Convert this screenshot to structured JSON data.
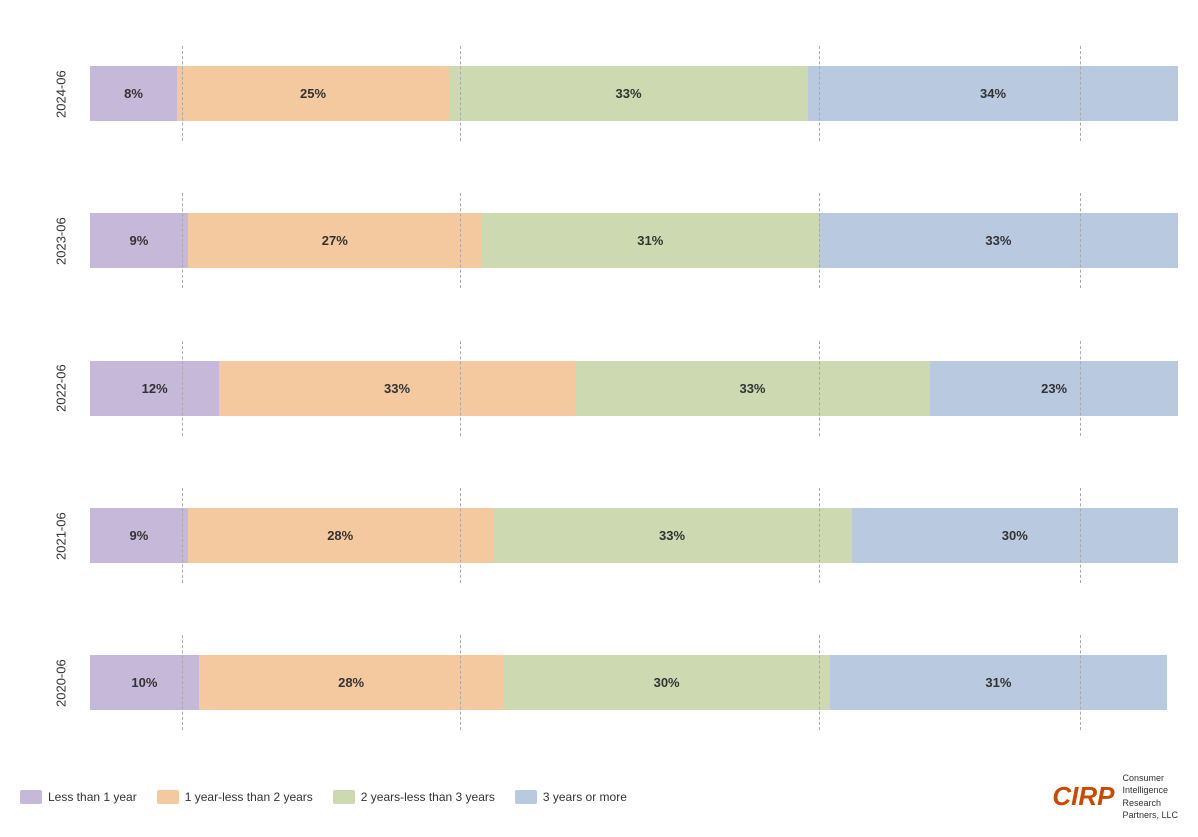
{
  "chart": {
    "bars": [
      {
        "year": "2024-06",
        "segments": [
          {
            "label": "8%",
            "pct": 8,
            "class": "seg-purple"
          },
          {
            "label": "25%",
            "pct": 25,
            "class": "seg-orange"
          },
          {
            "label": "33%",
            "pct": 33,
            "class": "seg-green"
          },
          {
            "label": "34%",
            "pct": 34,
            "class": "seg-blue"
          }
        ]
      },
      {
        "year": "2023-06",
        "segments": [
          {
            "label": "9%",
            "pct": 9,
            "class": "seg-purple"
          },
          {
            "label": "27%",
            "pct": 27,
            "class": "seg-orange"
          },
          {
            "label": "31%",
            "pct": 31,
            "class": "seg-green"
          },
          {
            "label": "33%",
            "pct": 33,
            "class": "seg-blue"
          }
        ]
      },
      {
        "year": "2022-06",
        "segments": [
          {
            "label": "12%",
            "pct": 12,
            "class": "seg-purple"
          },
          {
            "label": "33%",
            "pct": 33,
            "class": "seg-orange"
          },
          {
            "label": "33%",
            "pct": 33,
            "class": "seg-green"
          },
          {
            "label": "23%",
            "pct": 23,
            "class": "seg-blue"
          }
        ]
      },
      {
        "year": "2021-06",
        "segments": [
          {
            "label": "9%",
            "pct": 9,
            "class": "seg-purple"
          },
          {
            "label": "28%",
            "pct": 28,
            "class": "seg-orange"
          },
          {
            "label": "33%",
            "pct": 33,
            "class": "seg-green"
          },
          {
            "label": "30%",
            "pct": 30,
            "class": "seg-blue"
          }
        ]
      },
      {
        "year": "2020-06",
        "segments": [
          {
            "label": "10%",
            "pct": 10,
            "class": "seg-purple"
          },
          {
            "label": "28%",
            "pct": 28,
            "class": "seg-orange"
          },
          {
            "label": "30%",
            "pct": 30,
            "class": "seg-green"
          },
          {
            "label": "31%",
            "pct": 31,
            "class": "seg-blue"
          }
        ]
      }
    ],
    "grid_lines_pct": [
      8,
      33,
      66,
      92
    ],
    "legend": [
      {
        "label": "Less than 1 year",
        "class": "seg-purple"
      },
      {
        "label": "1 year-less than 2 years",
        "class": "seg-orange"
      },
      {
        "label": "2 years-less than 3 years",
        "class": "seg-green"
      },
      {
        "label": "3 years or more",
        "class": "seg-blue"
      }
    ]
  },
  "brand": {
    "logo_text": "CIRP",
    "company_line1": "Consumer",
    "company_line2": "Intelligence",
    "company_line3": "Research",
    "company_line4": "Partners, LLC"
  }
}
